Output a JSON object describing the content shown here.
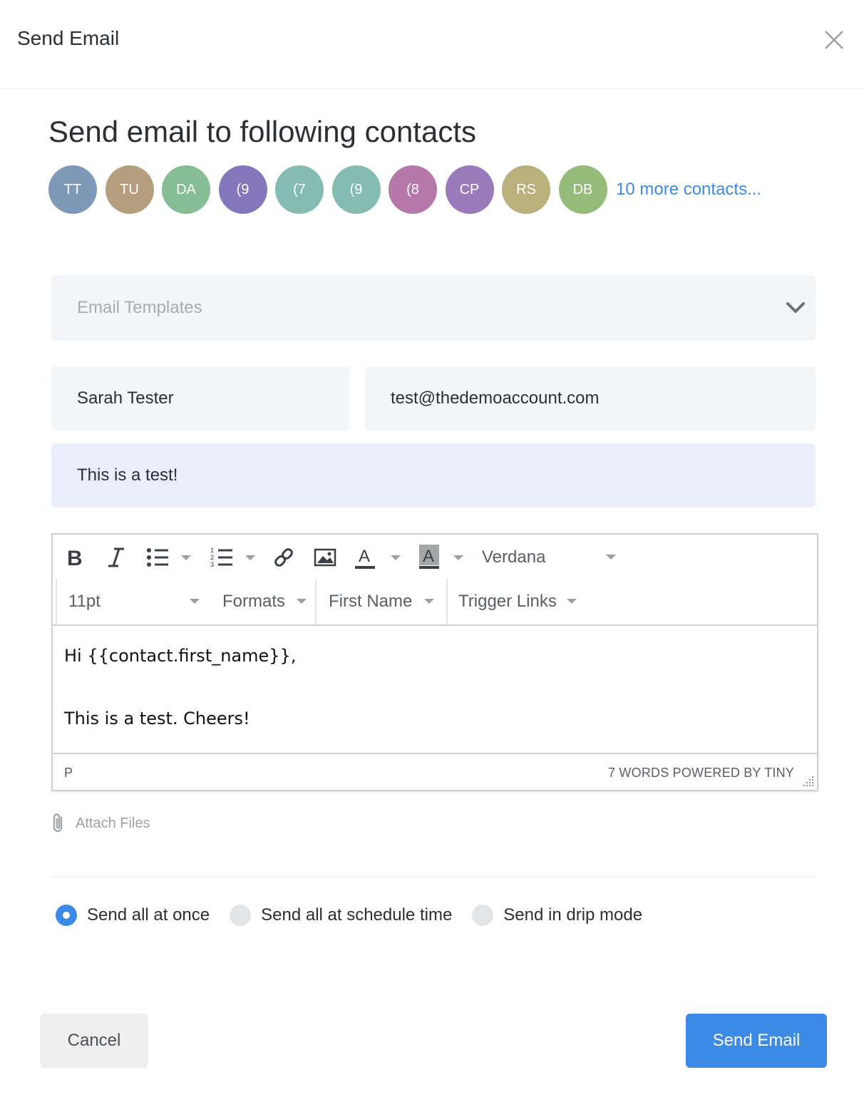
{
  "dialog": {
    "title": "Send Email"
  },
  "heading": "Send email to following contacts",
  "contacts": [
    {
      "initials": "TT",
      "color": "#7e99b8"
    },
    {
      "initials": "TU",
      "color": "#b59e7e"
    },
    {
      "initials": "DA",
      "color": "#86bd94"
    },
    {
      "initials": "(9",
      "color": "#8577bb"
    },
    {
      "initials": "(7",
      "color": "#84bcb4"
    },
    {
      "initials": "(9",
      "color": "#84bcb4"
    },
    {
      "initials": "(8",
      "color": "#b578a8"
    },
    {
      "initials": "CP",
      "color": "#997abb"
    },
    {
      "initials": "RS",
      "color": "#b9b07c"
    },
    {
      "initials": "DB",
      "color": "#95bb7b"
    }
  ],
  "more_contacts": "10 more contacts...",
  "templates": {
    "placeholder": "Email Templates"
  },
  "from_name": "Sarah Tester",
  "from_email": "test@thedemoaccount.com",
  "subject": "This is a test!",
  "editor": {
    "toolbar_icons": [
      "bold-icon",
      "italic-icon",
      "bullet-list-icon",
      "numbered-list-icon",
      "link-icon",
      "image-icon",
      "text-color-icon",
      "background-color-icon"
    ],
    "font_family": "Verdana",
    "font_size": "11pt",
    "formats": "Formats",
    "first_name": "First Name",
    "trigger_links": "Trigger Links",
    "line1": "Hi {{contact.first_name}},",
    "line2": "This is a test. Cheers!",
    "path": "P",
    "status": "7 WORDS POWERED BY TINY"
  },
  "attach_label": "Attach Files",
  "send_options": [
    {
      "label": "Send all at once",
      "selected": true
    },
    {
      "label": "Send all at schedule time",
      "selected": false
    },
    {
      "label": "Send in drip mode",
      "selected": false
    }
  ],
  "buttons": {
    "cancel": "Cancel",
    "send": "Send Email"
  },
  "colors": {
    "accent": "#3b8ae6",
    "field_bg": "#f3f6f9",
    "subject_bg": "#e8effb"
  }
}
